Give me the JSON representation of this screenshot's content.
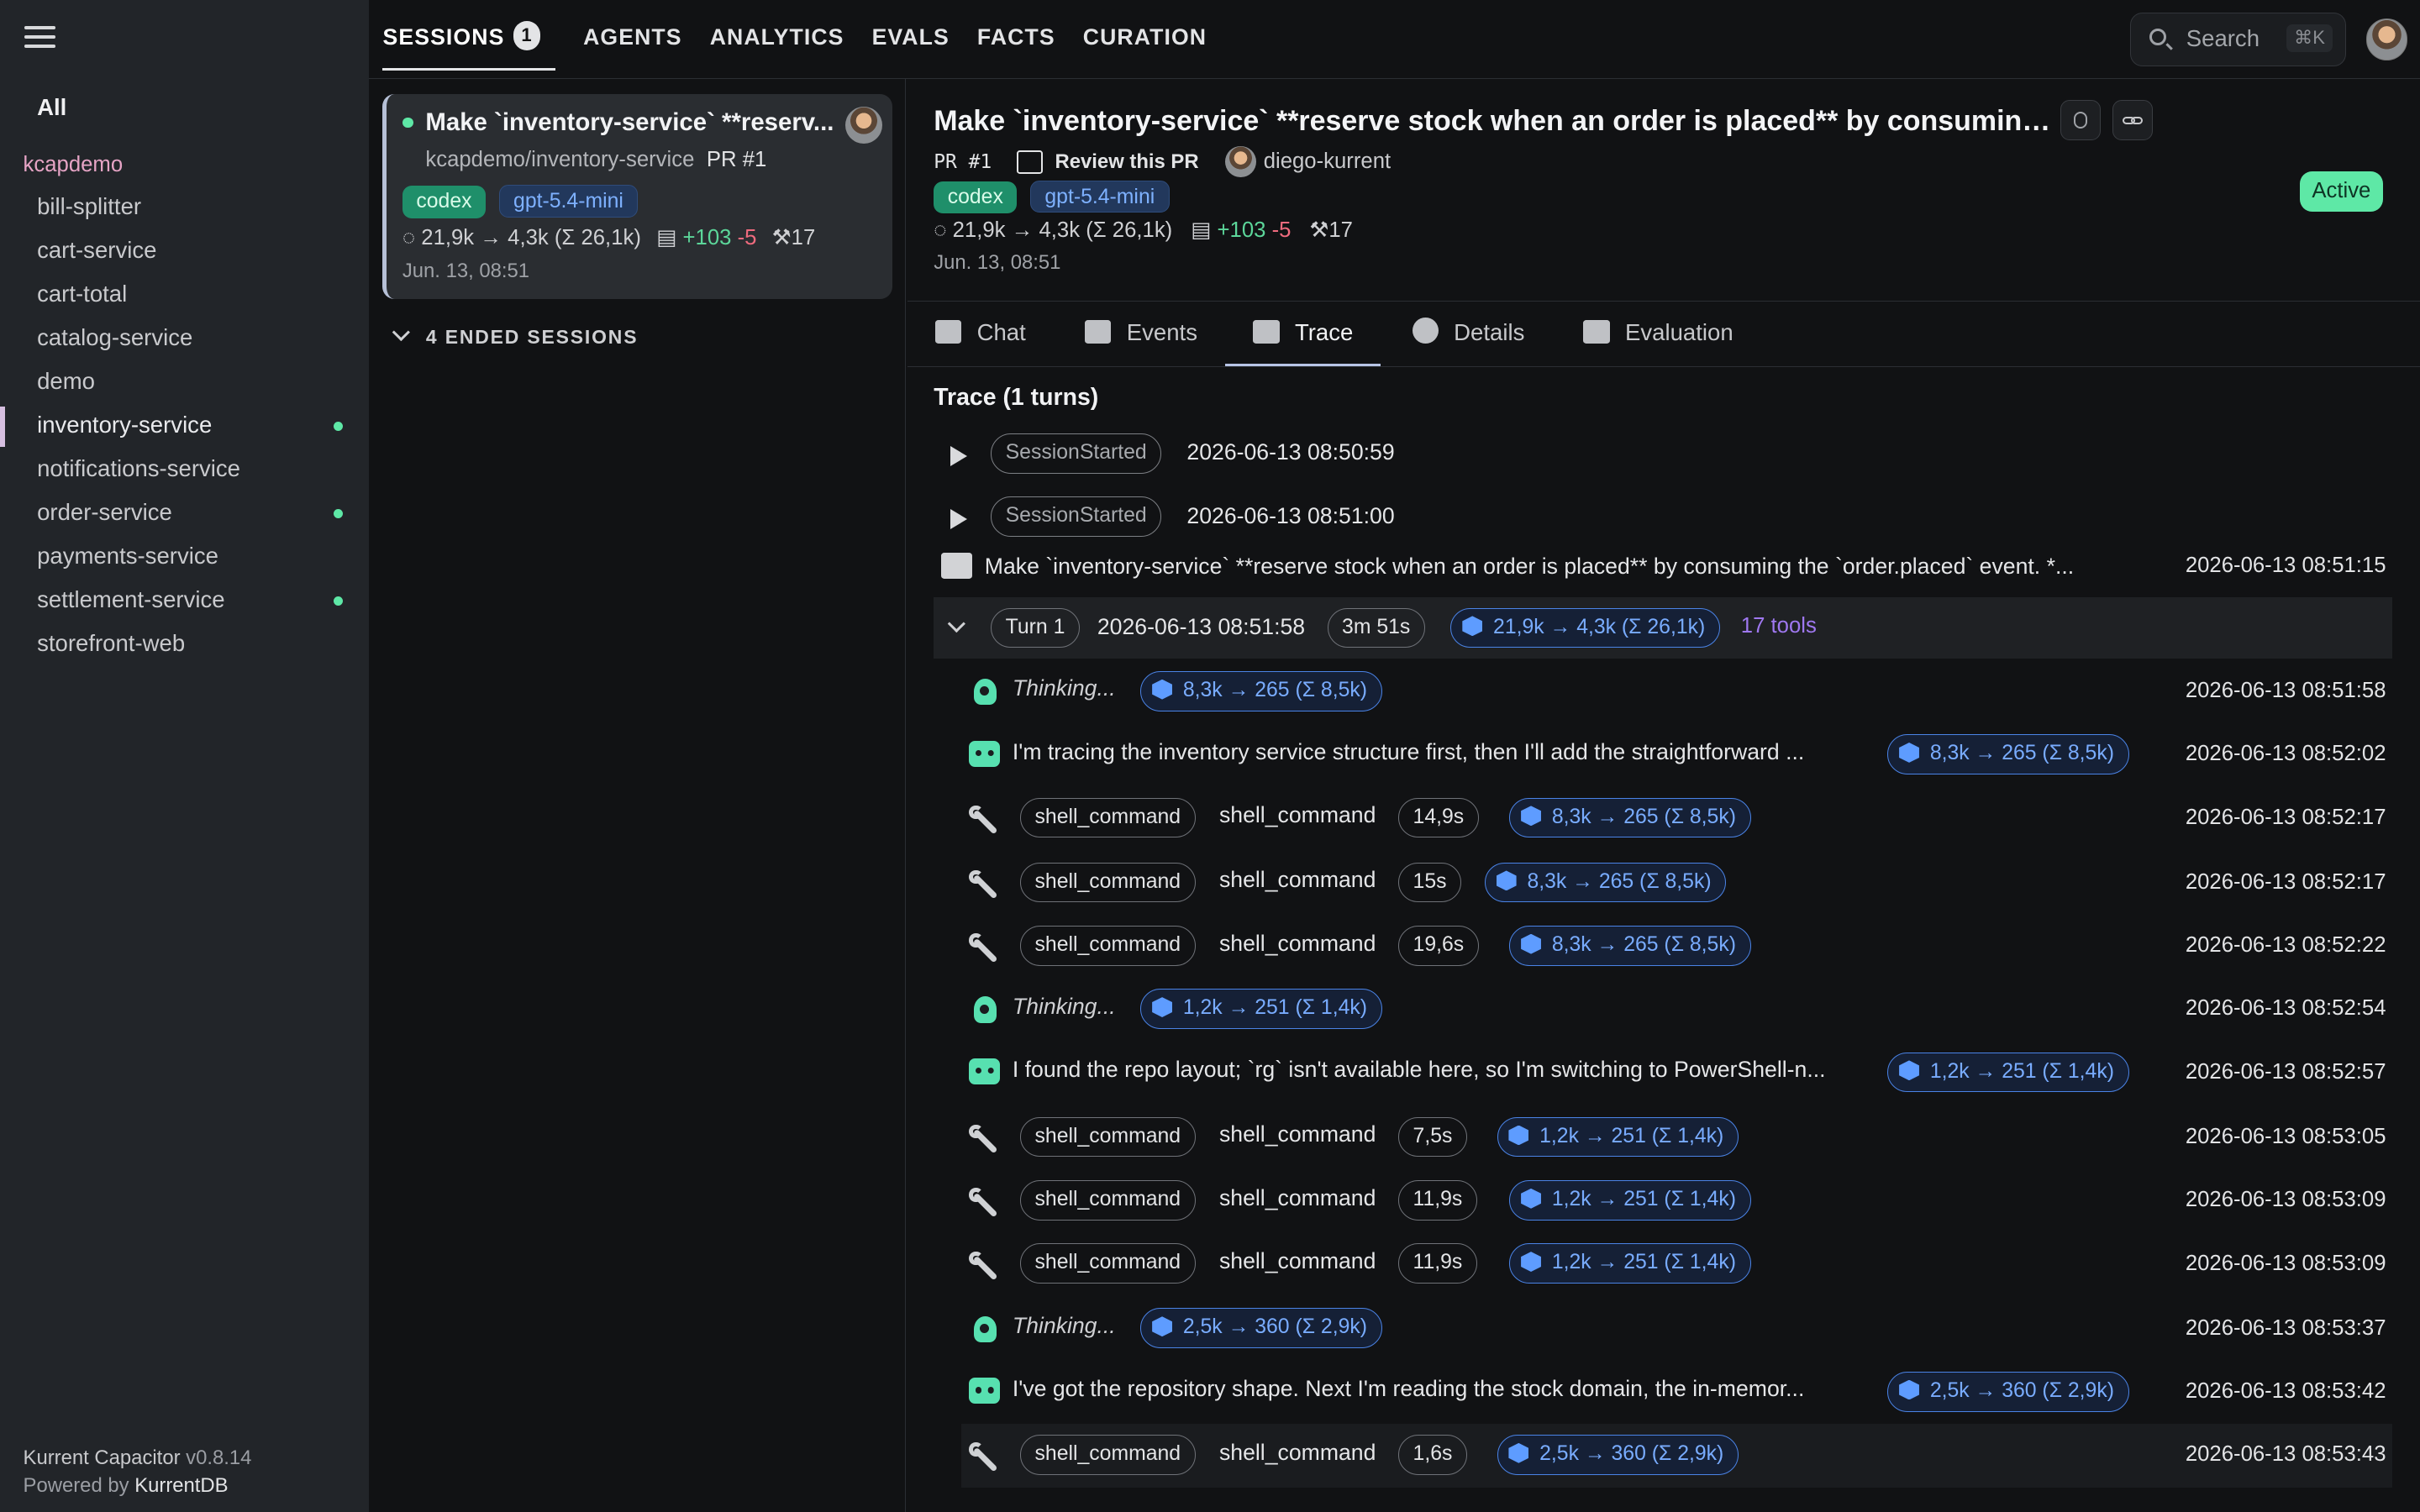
{
  "sidebar": {
    "all_label": "All",
    "org": "kcapdemo",
    "items": [
      {
        "label": "bill-splitter",
        "dot": false
      },
      {
        "label": "cart-service",
        "dot": false
      },
      {
        "label": "cart-total",
        "dot": false
      },
      {
        "label": "catalog-service",
        "dot": false
      },
      {
        "label": "demo",
        "dot": false
      },
      {
        "label": "inventory-service",
        "dot": true
      },
      {
        "label": "notifications-service",
        "dot": false
      },
      {
        "label": "order-service",
        "dot": true
      },
      {
        "label": "payments-service",
        "dot": false
      },
      {
        "label": "settlement-service",
        "dot": true
      },
      {
        "label": "storefront-web",
        "dot": false
      }
    ],
    "footer_app": "Kurrent Capacitor",
    "footer_version": "v0.8.14",
    "footer_powered": "Powered by",
    "footer_db": "KurrentDB"
  },
  "nav": {
    "tabs": [
      "SESSIONS",
      "AGENTS",
      "ANALYTICS",
      "EVALS",
      "FACTS",
      "CURATION"
    ],
    "sessions_badge": "1",
    "search_placeholder": "Search",
    "search_shortcut": "⌘K"
  },
  "session_card": {
    "title": "Make `inventory-service` **reserv...",
    "repo": "kcapdemo/inventory-service",
    "pr": "PR #1",
    "agent": "codex",
    "model": "gpt-5.4-mini",
    "tokens": "21,9k → 4,3k (Σ 26,1k)",
    "plus": "+103",
    "minus": "-5",
    "tools": "17",
    "date": "Jun. 13, 08:51"
  },
  "ended_sessions": "4 ENDED SESSIONS",
  "header": {
    "title": "Make `inventory-service` **reserve stock when an order is placed** by consuming...",
    "pr": "PR #1",
    "review": "Review this PR",
    "user": "diego-kurrent",
    "agent": "codex",
    "model": "gpt-5.4-mini",
    "tokens": "21,9k → 4,3k (Σ 26,1k)",
    "plus": "+103",
    "minus": "-5",
    "tools": "17",
    "date": "Jun. 13, 08:51",
    "status": "Active"
  },
  "tabs": [
    "Chat",
    "Events",
    "Trace",
    "Details",
    "Evaluation"
  ],
  "trace": {
    "heading": "Trace (1 turns)",
    "session_started": "SessionStarted",
    "ss_times": [
      "2026-06-13 08:50:59",
      "2026-06-13 08:51:00"
    ],
    "prompt": "Make `inventory-service` **reserve stock when an order is placed** by consuming the `order.placed` event. *...",
    "prompt_time": "2026-06-13 08:51:15",
    "turn": {
      "label": "Turn 1",
      "time": "2026-06-13 08:51:58",
      "duration": "3m 51s",
      "tokens": "21,9k → 4,3k (Σ 26,1k)",
      "tools": "17 tools"
    },
    "steps": [
      {
        "kind": "think",
        "text": "Thinking...",
        "tokens": "8,3k → 265 (Σ 8,5k)",
        "time": "2026-06-13 08:51:58"
      },
      {
        "kind": "msg",
        "text": "I'm tracing the inventory service structure first, then I'll add the straightforward ...",
        "tokens": "8,3k → 265 (Σ 8,5k)",
        "time": "2026-06-13 08:52:02"
      },
      {
        "kind": "tool",
        "pill": "shell_command",
        "name": "shell_command",
        "dur": "14,9s",
        "tokens": "8,3k → 265 (Σ 8,5k)",
        "time": "2026-06-13 08:52:17"
      },
      {
        "kind": "tool",
        "pill": "shell_command",
        "name": "shell_command",
        "dur": "15s",
        "tokens": "8,3k → 265 (Σ 8,5k)",
        "time": "2026-06-13 08:52:17"
      },
      {
        "kind": "tool",
        "pill": "shell_command",
        "name": "shell_command",
        "dur": "19,6s",
        "tokens": "8,3k → 265 (Σ 8,5k)",
        "time": "2026-06-13 08:52:22"
      },
      {
        "kind": "think",
        "text": "Thinking...",
        "tokens": "1,2k → 251 (Σ 1,4k)",
        "time": "2026-06-13 08:52:54"
      },
      {
        "kind": "msg",
        "text": "I found the repo layout; `rg` isn't available here, so I'm switching to PowerShell-n...",
        "tokens": "1,2k → 251 (Σ 1,4k)",
        "time": "2026-06-13 08:52:57"
      },
      {
        "kind": "tool",
        "pill": "shell_command",
        "name": "shell_command",
        "dur": "7,5s",
        "tokens": "1,2k → 251 (Σ 1,4k)",
        "time": "2026-06-13 08:53:05"
      },
      {
        "kind": "tool",
        "pill": "shell_command",
        "name": "shell_command",
        "dur": "11,9s",
        "tokens": "1,2k → 251 (Σ 1,4k)",
        "time": "2026-06-13 08:53:09"
      },
      {
        "kind": "tool",
        "pill": "shell_command",
        "name": "shell_command",
        "dur": "11,9s",
        "tokens": "1,2k → 251 (Σ 1,4k)",
        "time": "2026-06-13 08:53:09"
      },
      {
        "kind": "think",
        "text": "Thinking...",
        "tokens": "2,5k → 360 (Σ 2,9k)",
        "time": "2026-06-13 08:53:37"
      },
      {
        "kind": "msg",
        "text": "I've got the repository shape. Next I'm reading the stock domain, the in-memor...",
        "tokens": "2,5k → 360 (Σ 2,9k)",
        "time": "2026-06-13 08:53:42"
      },
      {
        "kind": "tool",
        "pill": "shell_command",
        "name": "shell_command",
        "dur": "1,6s",
        "tokens": "2,5k → 360 (Σ 2,9k)",
        "time": "2026-06-13 08:53:43"
      }
    ]
  }
}
